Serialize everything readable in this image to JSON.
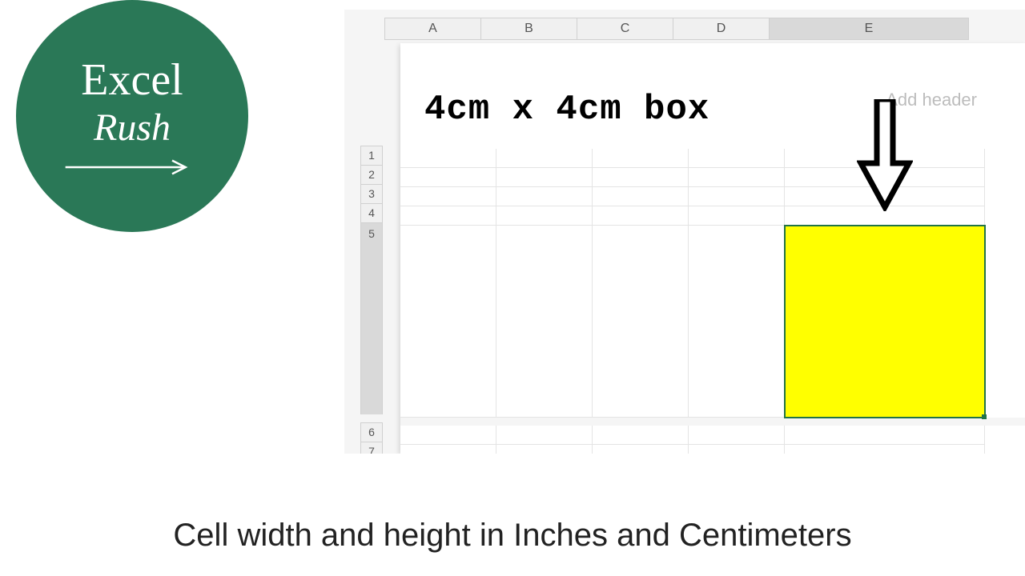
{
  "logo": {
    "line1": "Excel",
    "line2": "Rush"
  },
  "spreadsheet": {
    "columns": [
      "A",
      "B",
      "C",
      "D",
      "E"
    ],
    "selected_column": "E",
    "rows": [
      "1",
      "2",
      "3",
      "4",
      "5",
      "6",
      "7"
    ],
    "tall_row": "5",
    "selected_row": "5",
    "header_placeholder": "Add header",
    "selected_cell": "E5",
    "selected_fill_color": "#ffff00"
  },
  "overlay": {
    "title": "4cm x 4cm box"
  },
  "caption": "Cell width and height in Inches and Centimeters"
}
